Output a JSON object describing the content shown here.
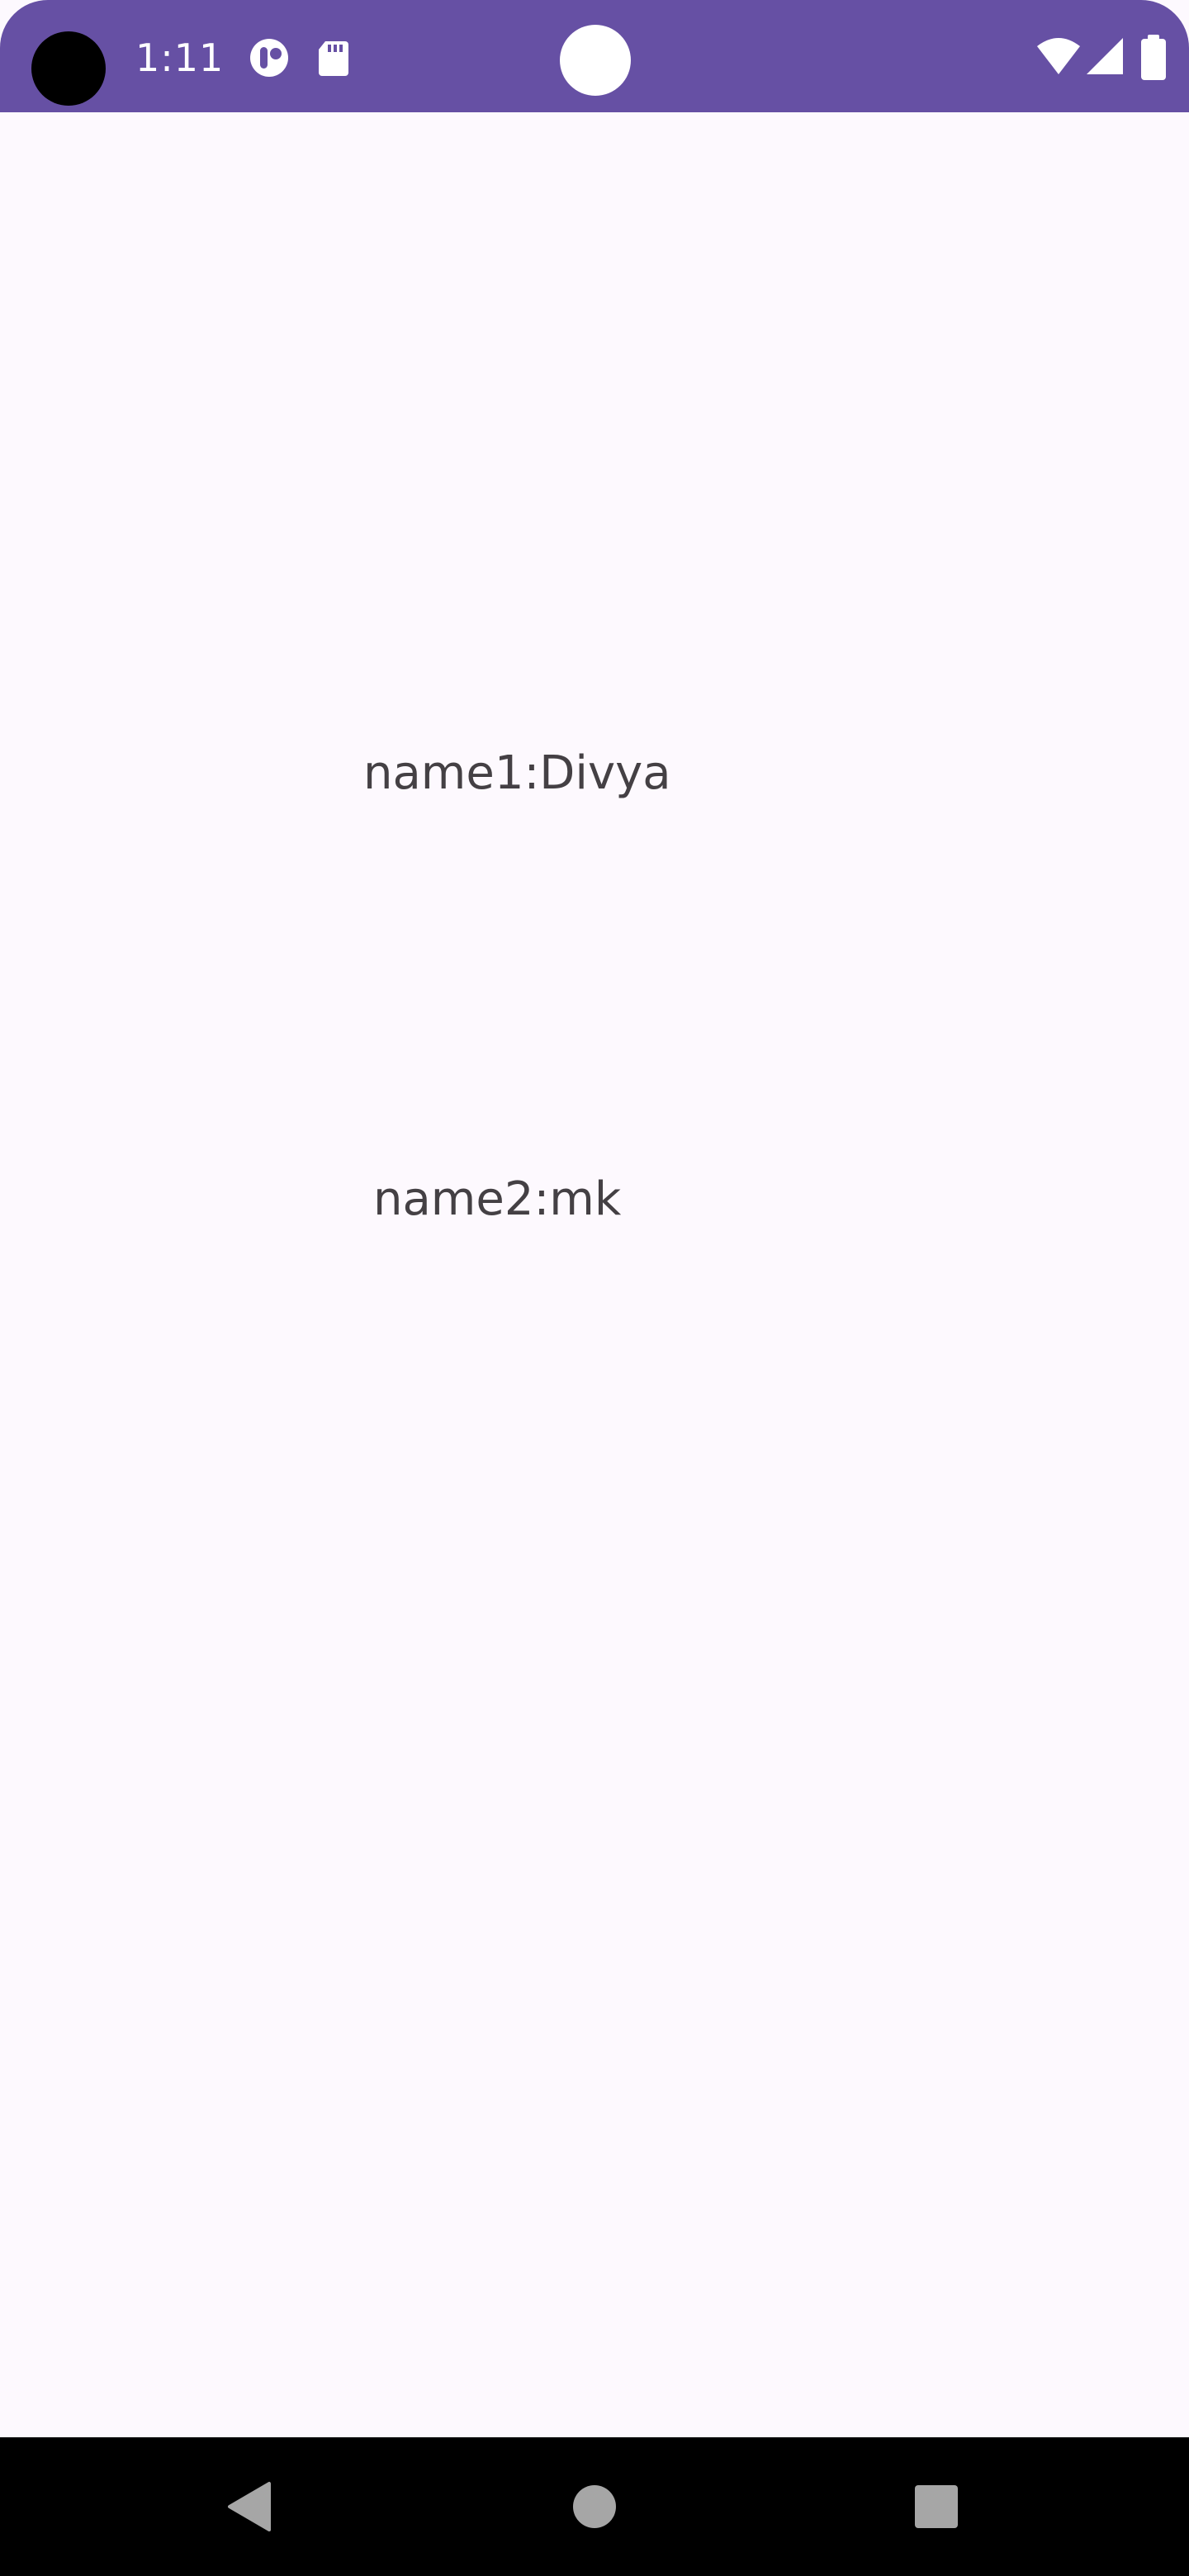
{
  "status_bar": {
    "time": "1:11",
    "background_color": "#6650A4",
    "notification_icons": [
      "privacy-indicator-icon",
      "sd-card-icon"
    ],
    "system_icons": [
      "wifi-icon",
      "cellular-signal-icon",
      "battery-icon"
    ]
  },
  "main": {
    "background_color": "#FDF9FE",
    "name1_text": "name1:Divya",
    "name2_text": "name2:mk"
  },
  "nav_bar": {
    "buttons": [
      "back-icon",
      "home-icon",
      "recents-icon"
    ]
  }
}
